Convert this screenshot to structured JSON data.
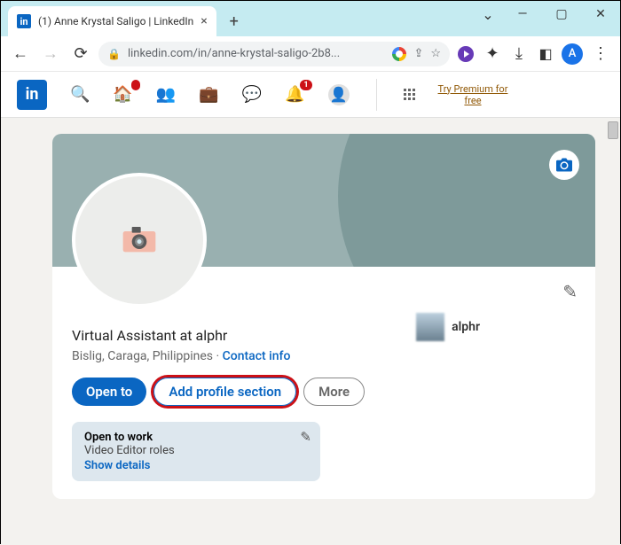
{
  "browser": {
    "tab_title": "(1) Anne Krystal Saligo | LinkedIn",
    "url_display": "linkedin.com/in/anne-krystal-saligo-2b8...",
    "avatar_letter": "A"
  },
  "topnav": {
    "home_badge": "",
    "notif_badge": "1",
    "premium_line1": "Try Premium for",
    "premium_line2": "free"
  },
  "profile": {
    "headline": "Virtual Assistant at alphr",
    "location": "Bislig, Caraga, Philippines",
    "contact_label": "Contact info",
    "company_name": "alphr",
    "buttons": {
      "open_to": "Open to",
      "add_section": "Add profile section",
      "more": "More"
    },
    "open_to_work": {
      "title": "Open to work",
      "subtitle": "Video Editor roles",
      "details": "Show details"
    }
  }
}
